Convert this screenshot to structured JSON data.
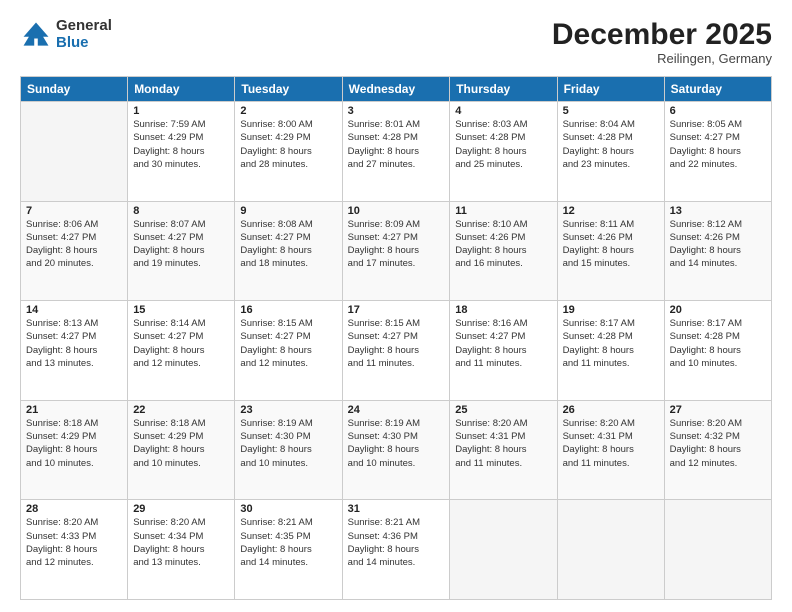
{
  "logo": {
    "general": "General",
    "blue": "Blue"
  },
  "header": {
    "month": "December 2025",
    "location": "Reilingen, Germany"
  },
  "days_of_week": [
    "Sunday",
    "Monday",
    "Tuesday",
    "Wednesday",
    "Thursday",
    "Friday",
    "Saturday"
  ],
  "weeks": [
    [
      {
        "day": "",
        "sunrise": "",
        "sunset": "",
        "daylight": ""
      },
      {
        "day": "1",
        "sunrise": "Sunrise: 7:59 AM",
        "sunset": "Sunset: 4:29 PM",
        "daylight": "Daylight: 8 hours and 30 minutes."
      },
      {
        "day": "2",
        "sunrise": "Sunrise: 8:00 AM",
        "sunset": "Sunset: 4:29 PM",
        "daylight": "Daylight: 8 hours and 28 minutes."
      },
      {
        "day": "3",
        "sunrise": "Sunrise: 8:01 AM",
        "sunset": "Sunset: 4:28 PM",
        "daylight": "Daylight: 8 hours and 27 minutes."
      },
      {
        "day": "4",
        "sunrise": "Sunrise: 8:03 AM",
        "sunset": "Sunset: 4:28 PM",
        "daylight": "Daylight: 8 hours and 25 minutes."
      },
      {
        "day": "5",
        "sunrise": "Sunrise: 8:04 AM",
        "sunset": "Sunset: 4:28 PM",
        "daylight": "Daylight: 8 hours and 23 minutes."
      },
      {
        "day": "6",
        "sunrise": "Sunrise: 8:05 AM",
        "sunset": "Sunset: 4:27 PM",
        "daylight": "Daylight: 8 hours and 22 minutes."
      }
    ],
    [
      {
        "day": "7",
        "sunrise": "Sunrise: 8:06 AM",
        "sunset": "Sunset: 4:27 PM",
        "daylight": "Daylight: 8 hours and 20 minutes."
      },
      {
        "day": "8",
        "sunrise": "Sunrise: 8:07 AM",
        "sunset": "Sunset: 4:27 PM",
        "daylight": "Daylight: 8 hours and 19 minutes."
      },
      {
        "day": "9",
        "sunrise": "Sunrise: 8:08 AM",
        "sunset": "Sunset: 4:27 PM",
        "daylight": "Daylight: 8 hours and 18 minutes."
      },
      {
        "day": "10",
        "sunrise": "Sunrise: 8:09 AM",
        "sunset": "Sunset: 4:27 PM",
        "daylight": "Daylight: 8 hours and 17 minutes."
      },
      {
        "day": "11",
        "sunrise": "Sunrise: 8:10 AM",
        "sunset": "Sunset: 4:26 PM",
        "daylight": "Daylight: 8 hours and 16 minutes."
      },
      {
        "day": "12",
        "sunrise": "Sunrise: 8:11 AM",
        "sunset": "Sunset: 4:26 PM",
        "daylight": "Daylight: 8 hours and 15 minutes."
      },
      {
        "day": "13",
        "sunrise": "Sunrise: 8:12 AM",
        "sunset": "Sunset: 4:26 PM",
        "daylight": "Daylight: 8 hours and 14 minutes."
      }
    ],
    [
      {
        "day": "14",
        "sunrise": "Sunrise: 8:13 AM",
        "sunset": "Sunset: 4:27 PM",
        "daylight": "Daylight: 8 hours and 13 minutes."
      },
      {
        "day": "15",
        "sunrise": "Sunrise: 8:14 AM",
        "sunset": "Sunset: 4:27 PM",
        "daylight": "Daylight: 8 hours and 12 minutes."
      },
      {
        "day": "16",
        "sunrise": "Sunrise: 8:15 AM",
        "sunset": "Sunset: 4:27 PM",
        "daylight": "Daylight: 8 hours and 12 minutes."
      },
      {
        "day": "17",
        "sunrise": "Sunrise: 8:15 AM",
        "sunset": "Sunset: 4:27 PM",
        "daylight": "Daylight: 8 hours and 11 minutes."
      },
      {
        "day": "18",
        "sunrise": "Sunrise: 8:16 AM",
        "sunset": "Sunset: 4:27 PM",
        "daylight": "Daylight: 8 hours and 11 minutes."
      },
      {
        "day": "19",
        "sunrise": "Sunrise: 8:17 AM",
        "sunset": "Sunset: 4:28 PM",
        "daylight": "Daylight: 8 hours and 11 minutes."
      },
      {
        "day": "20",
        "sunrise": "Sunrise: 8:17 AM",
        "sunset": "Sunset: 4:28 PM",
        "daylight": "Daylight: 8 hours and 10 minutes."
      }
    ],
    [
      {
        "day": "21",
        "sunrise": "Sunrise: 8:18 AM",
        "sunset": "Sunset: 4:29 PM",
        "daylight": "Daylight: 8 hours and 10 minutes."
      },
      {
        "day": "22",
        "sunrise": "Sunrise: 8:18 AM",
        "sunset": "Sunset: 4:29 PM",
        "daylight": "Daylight: 8 hours and 10 minutes."
      },
      {
        "day": "23",
        "sunrise": "Sunrise: 8:19 AM",
        "sunset": "Sunset: 4:30 PM",
        "daylight": "Daylight: 8 hours and 10 minutes."
      },
      {
        "day": "24",
        "sunrise": "Sunrise: 8:19 AM",
        "sunset": "Sunset: 4:30 PM",
        "daylight": "Daylight: 8 hours and 10 minutes."
      },
      {
        "day": "25",
        "sunrise": "Sunrise: 8:20 AM",
        "sunset": "Sunset: 4:31 PM",
        "daylight": "Daylight: 8 hours and 11 minutes."
      },
      {
        "day": "26",
        "sunrise": "Sunrise: 8:20 AM",
        "sunset": "Sunset: 4:31 PM",
        "daylight": "Daylight: 8 hours and 11 minutes."
      },
      {
        "day": "27",
        "sunrise": "Sunrise: 8:20 AM",
        "sunset": "Sunset: 4:32 PM",
        "daylight": "Daylight: 8 hours and 12 minutes."
      }
    ],
    [
      {
        "day": "28",
        "sunrise": "Sunrise: 8:20 AM",
        "sunset": "Sunset: 4:33 PM",
        "daylight": "Daylight: 8 hours and 12 minutes."
      },
      {
        "day": "29",
        "sunrise": "Sunrise: 8:20 AM",
        "sunset": "Sunset: 4:34 PM",
        "daylight": "Daylight: 8 hours and 13 minutes."
      },
      {
        "day": "30",
        "sunrise": "Sunrise: 8:21 AM",
        "sunset": "Sunset: 4:35 PM",
        "daylight": "Daylight: 8 hours and 14 minutes."
      },
      {
        "day": "31",
        "sunrise": "Sunrise: 8:21 AM",
        "sunset": "Sunset: 4:36 PM",
        "daylight": "Daylight: 8 hours and 14 minutes."
      },
      {
        "day": "",
        "sunrise": "",
        "sunset": "",
        "daylight": ""
      },
      {
        "day": "",
        "sunrise": "",
        "sunset": "",
        "daylight": ""
      },
      {
        "day": "",
        "sunrise": "",
        "sunset": "",
        "daylight": ""
      }
    ]
  ]
}
